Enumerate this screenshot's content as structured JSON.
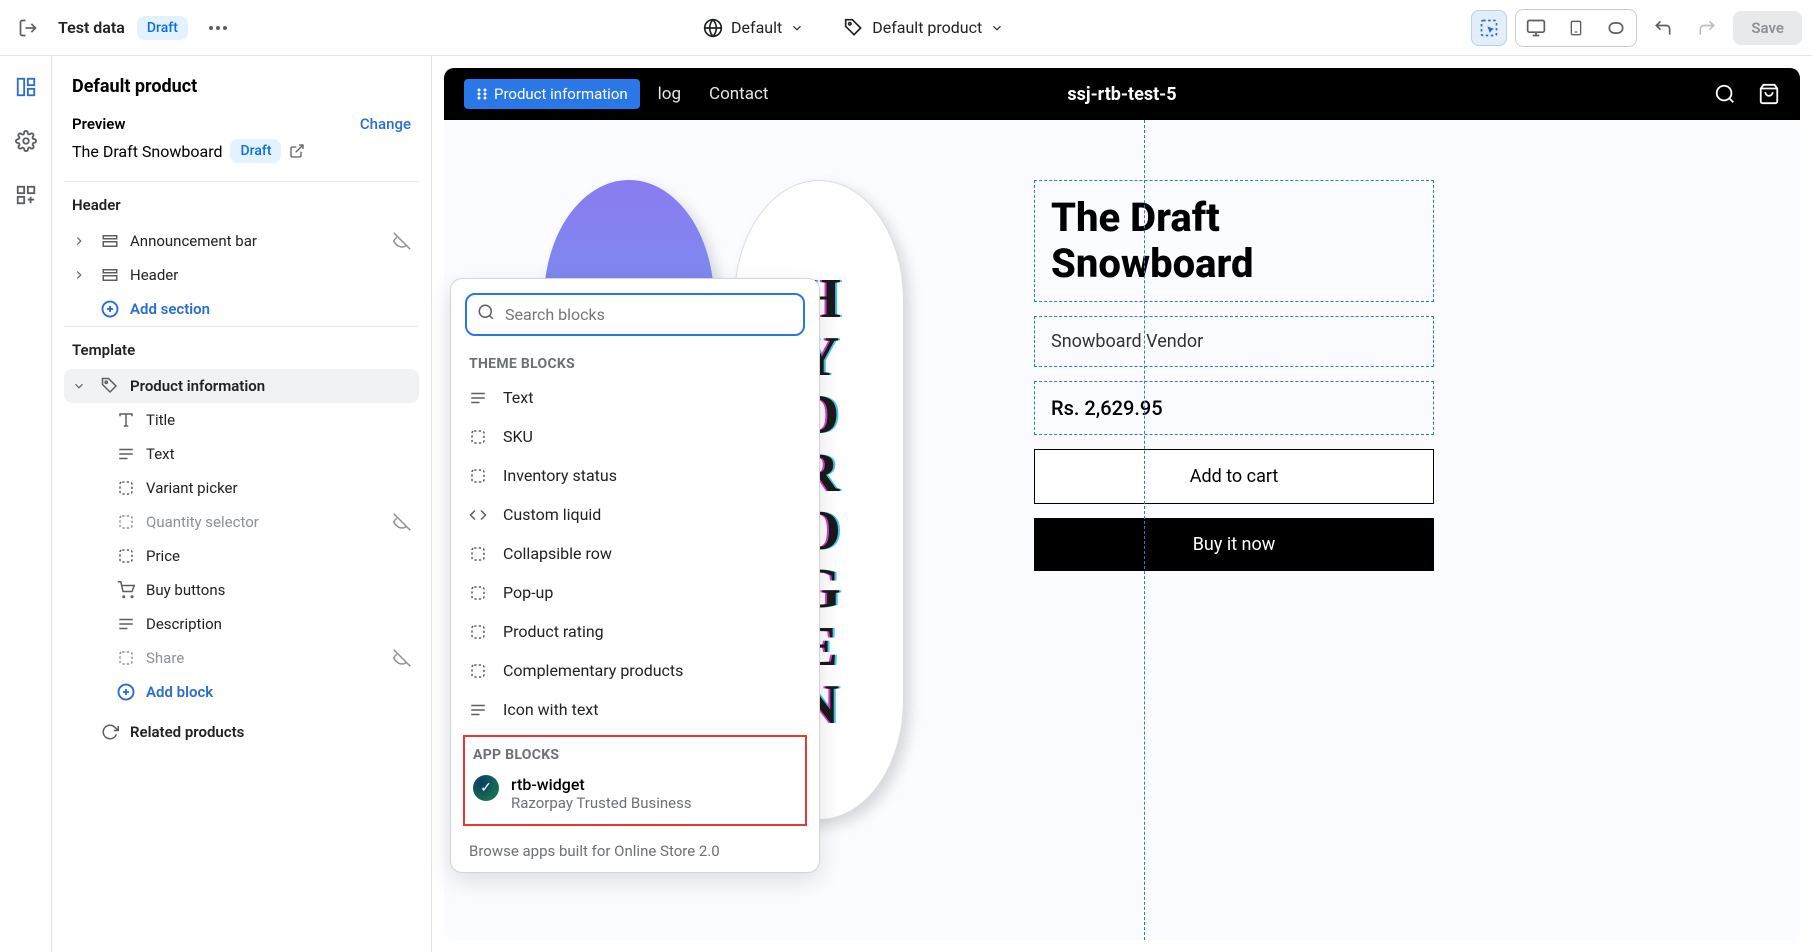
{
  "topbar": {
    "test_data": "Test data",
    "draft": "Draft",
    "default_lang": "Default",
    "default_template": "Default product",
    "save": "Save"
  },
  "sidebar": {
    "title": "Default product",
    "preview_label": "Preview",
    "change": "Change",
    "preview_product": "The Draft Snowboard",
    "preview_draft": "Draft",
    "header_label": "Header",
    "announcement": "Announcement bar",
    "header_item": "Header",
    "add_section": "Add section",
    "template_label": "Template",
    "product_info": "Product information",
    "blocks": {
      "title": "Title",
      "text": "Text",
      "variant": "Variant picker",
      "quantity": "Quantity selector",
      "price": "Price",
      "buy": "Buy buttons",
      "description": "Description",
      "share": "Share"
    },
    "add_block": "Add block",
    "related": "Related products"
  },
  "popup": {
    "search_placeholder": "Search blocks",
    "theme_blocks": "THEME BLOCKS",
    "items": {
      "text": "Text",
      "sku": "SKU",
      "inventory": "Inventory status",
      "liquid": "Custom liquid",
      "collapsible": "Collapsible row",
      "popup": "Pop-up",
      "rating": "Product rating",
      "complementary": "Complementary products",
      "icon_text": "Icon with text"
    },
    "app_blocks": "APP BLOCKS",
    "app_name": "rtb-widget",
    "app_sub": "Razorpay Trusted Business",
    "browse": "Browse apps built for Online Store 2.0"
  },
  "preview": {
    "pi_chip": "Product information",
    "nav_log": "log",
    "nav_contact": "Contact",
    "site_title": "ssj-rtb-test-5",
    "product_title": "The Draft Snowboard",
    "vendor": "Snowboard Vendor",
    "price": "Rs. 2,629.95",
    "add_to_cart": "Add to cart",
    "buy_now": "Buy it now",
    "hydrogen": "HYDROGEN"
  }
}
